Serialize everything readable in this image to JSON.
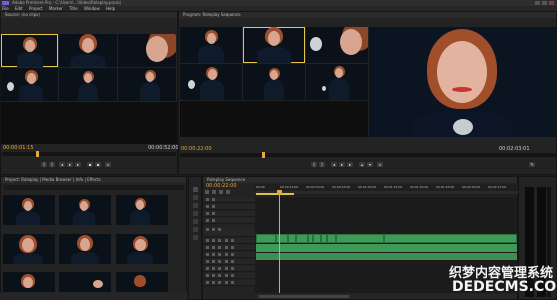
{
  "window": {
    "title": "Adobe Premiere Pro - C:\\Users\\...\\Video\\Roleplay.prproj"
  },
  "menu": [
    "File",
    "Edit",
    "Project",
    "Marker",
    "Title",
    "Window",
    "Help"
  ],
  "source_monitor": {
    "tab_label": "Source: (no clips)",
    "timecode_left": "00:00:01:15",
    "timecode_right": "00:00:52:00"
  },
  "program_monitor": {
    "tab_label": "Program: Roleplay Sequence",
    "timecode_left": "00:00:22:00",
    "timecode_right": "00:02:03:01",
    "corner_label": "1/2 ▾"
  },
  "project_panel": {
    "tab_label": "Project: Roleplay | Media Browser | Info | Effects"
  },
  "timeline": {
    "tab_label": "Roleplay Sequence",
    "playhead": "00:00:22:00",
    "ruler_labels": [
      "00:00",
      "00:00:15:00",
      "00:00:30:00",
      "00:00:45:00",
      "00:01:00:00",
      "00:01:15:00",
      "00:01:30:00",
      "00:01:45:00",
      "00:02:00:00",
      "00:02:15:00"
    ]
  },
  "watermark": {
    "line1": "织梦内容管理系统",
    "line2": "DEDECMS.COM"
  },
  "colors": {
    "timecode": "#e8a73a",
    "clip_green": "#3f9a57",
    "highlight": "#e5c54a",
    "playhead": "#e8a73a"
  }
}
